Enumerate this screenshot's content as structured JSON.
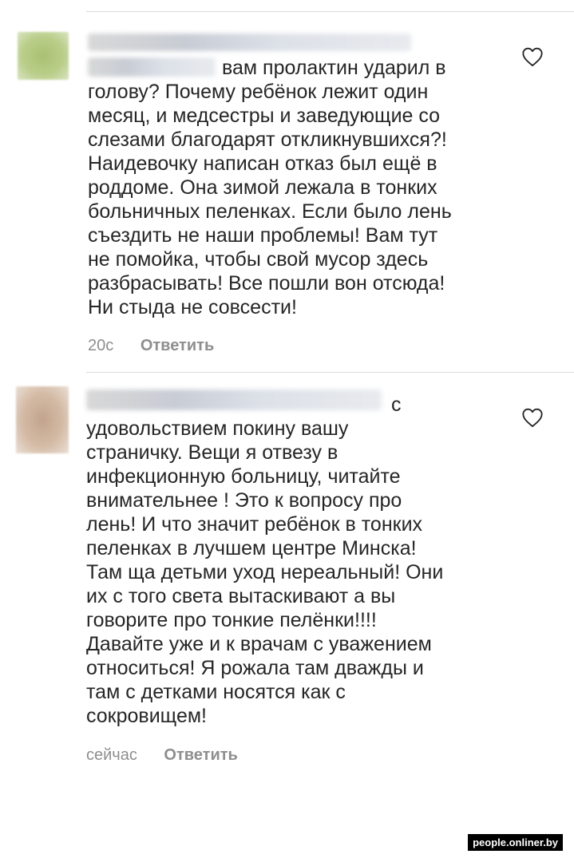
{
  "comments": [
    {
      "author_prefix_fragment": "",
      "text": "вам пролактин ударил в\nголову? Почему ребёнок лежит один\nмесяц, и медсестры и заведующие со\nслезами благодарят откликнувшихся?!\nНаидевочку написан отказ был ещё в\nроддоме. Она зимой лежала в тонких\nбольничных пеленках. Если было лень\nсъездить не наши проблемы! Вам тут\nне помойка, чтобы свой мусор здесь\nразбрасывать! Все пошли вон отсюда!\nНи стыда не совсести!",
      "time": "20с",
      "reply_label": "Ответить"
    },
    {
      "first_line_tail": "с",
      "text": "удовольствием покину вашу\nстраничку. Вещи я отвезу в\nинфекционную больницу, читайте\nвнимательнее ! Это к вопросу про\nлень! И что значит ребёнок в тонких\nпеленках в лучшем центре Минска!\nТам ща детьми уход нереальный! Они\nих с того света вытаскивают а вы\nговорите про тонкие пелёнки!!!!\nДавайте уже и к врачам с уважением\nотноситься! Я рожала там дважды и\nтам с детками носятся как с\nсокровищем!",
      "time": "сейчас",
      "reply_label": "Ответить"
    }
  ],
  "icons": {
    "like": "heart-outline-icon"
  },
  "watermark": "people.onliner.by"
}
